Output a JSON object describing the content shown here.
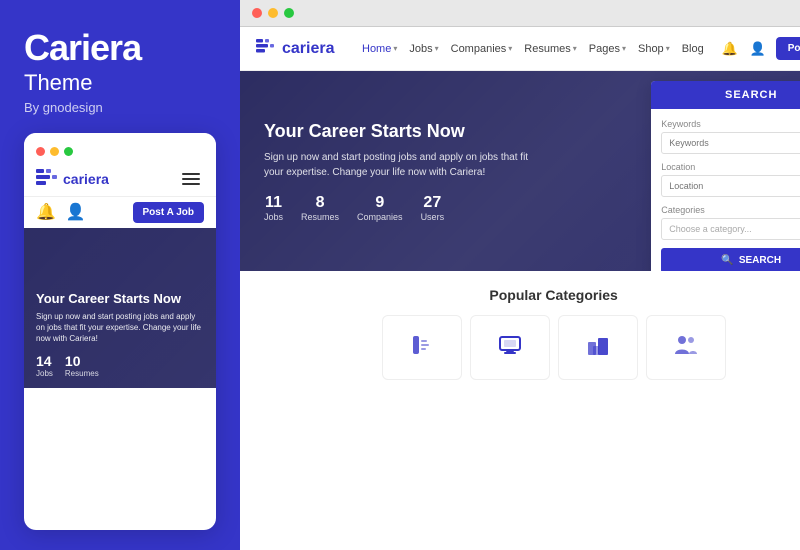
{
  "leftPanel": {
    "brandTitle": "Cariera",
    "brandSubtitle": "Theme",
    "byLine": "By gnodesign",
    "mobileCard": {
      "trafficLights": [
        "red",
        "yellow",
        "green"
      ],
      "logoText": "cariera",
      "heroTitle": "Your Career Starts Now",
      "heroDesc": "Sign up now and start posting jobs and apply on jobs that fit your expertise. Change your life now with Cariera!",
      "stats": [
        {
          "number": "14",
          "label": "Jobs"
        },
        {
          "number": "10",
          "label": "Resumes"
        }
      ],
      "postJobBtn": "Post A Job"
    }
  },
  "rightPanel": {
    "browserLights": [
      "red",
      "yellow",
      "green"
    ],
    "nav": {
      "logoText": "cariera",
      "links": [
        {
          "label": "Home",
          "hasDropdown": true,
          "active": true
        },
        {
          "label": "Jobs",
          "hasDropdown": true
        },
        {
          "label": "Companies",
          "hasDropdown": true
        },
        {
          "label": "Resumes",
          "hasDropdown": true
        },
        {
          "label": "Pages",
          "hasDropdown": true
        },
        {
          "label": "Shop",
          "hasDropdown": true
        },
        {
          "label": "Blog",
          "hasDropdown": false
        }
      ],
      "postJobBtn": "Post A Job"
    },
    "hero": {
      "title": "Your Career Starts Now",
      "description": "Sign up now and start posting jobs and apply on jobs that fit your expertise.\nChange your life now with Cariera!",
      "stats": [
        {
          "number": "11",
          "label": "Jobs"
        },
        {
          "number": "8",
          "label": "Resumes"
        },
        {
          "number": "9",
          "label": "Companies"
        },
        {
          "number": "27",
          "label": "Users"
        }
      ]
    },
    "searchPanel": {
      "headerLabel": "SEARCH",
      "fields": [
        {
          "label": "Keywords",
          "placeholder": "Keywords",
          "type": "text"
        },
        {
          "label": "Location",
          "placeholder": "Location",
          "type": "location"
        },
        {
          "label": "Categories",
          "placeholder": "Choose a category...",
          "type": "select"
        }
      ],
      "searchBtnLabel": "SEARCH"
    },
    "popularSection": {
      "title": "Popular Categories",
      "categories": [
        {
          "icon": "✏️",
          "name": "design"
        },
        {
          "icon": "💻",
          "name": "technology"
        },
        {
          "icon": "🏢",
          "name": "business"
        },
        {
          "icon": "👥",
          "name": "people"
        }
      ]
    }
  },
  "colors": {
    "brand": "#3535c8",
    "heroBg": "#4a4a8a",
    "white": "#ffffff"
  }
}
